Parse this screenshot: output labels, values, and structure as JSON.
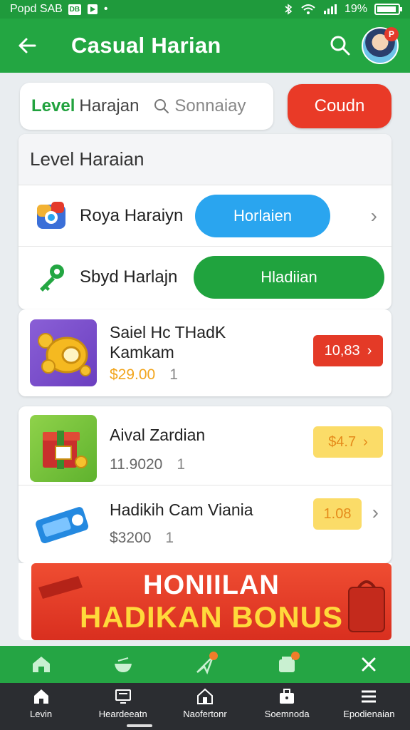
{
  "status_bar": {
    "left_text": "Popd SAB",
    "box_icon_text": "DB",
    "battery_text": "19%"
  },
  "app_bar": {
    "title": "Casual Harian",
    "avatar_badge": "P"
  },
  "search_row": {
    "level_label_a": "Level",
    "level_label_b": "Harajan",
    "search_placeholder": "Sonnaiay",
    "coupon_label": "Coudn"
  },
  "level_card": {
    "heading": "Level Haraian",
    "rows": [
      {
        "name": "Roya Haraiyn",
        "button": "Horlaien",
        "icon": "puzzle-game-icon"
      },
      {
        "name": "Sbyd Harlajn",
        "button": "Hladiian",
        "icon": "key-icon"
      }
    ]
  },
  "products": [
    {
      "title_line1": "Saiel Hc THadK",
      "title_line2": "Kamkam",
      "price": "$29.00",
      "qty": "1",
      "tag": "10,83",
      "tag_color": "#e43a27",
      "icon": "gold-coin-icon"
    },
    {
      "title_line1": "Aival Zardian",
      "title_line2": "",
      "price": "11.9020",
      "qty": "1",
      "tag": "$4.7",
      "tag_color": "#fbdc68",
      "icon": "gift-box-icon"
    },
    {
      "title_line1": "Hadikih Cam Viania",
      "title_line2": "",
      "price": "$3200",
      "qty": "1",
      "tag": "1.08",
      "tag_color": "#fbdc68",
      "icon": "ticket-icon"
    }
  ],
  "banner": {
    "line1": "HONIILAN",
    "line2": "HADIKAN BONUS"
  },
  "tab_icons": [
    "home-icon",
    "bowl-icon",
    "send-icon",
    "wallet-icon",
    "tools-icon"
  ],
  "bottom_nav": [
    {
      "label": "Levin",
      "icon": "home-icon"
    },
    {
      "label": "Heardeeatn",
      "icon": "monitor-icon"
    },
    {
      "label": "Naofertonr",
      "icon": "house-icon"
    },
    {
      "label": "Soemnoda",
      "icon": "briefcase-icon"
    },
    {
      "label": "Epodienaian",
      "icon": "menu-icon"
    }
  ],
  "colors": {
    "brand_green": "#23a642",
    "accent_red": "#e93a27",
    "accent_blue": "#2aa5ef",
    "accent_yellow": "#fbdc68"
  }
}
